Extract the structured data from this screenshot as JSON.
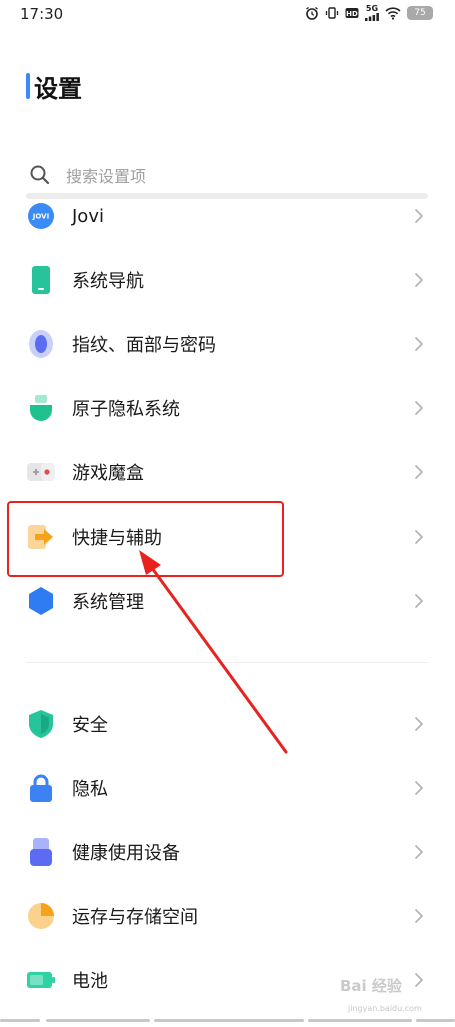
{
  "status_bar": {
    "time": "17:30",
    "network": "5G",
    "battery": "75"
  },
  "header": {
    "title": "设置"
  },
  "search": {
    "placeholder": "搜索设置项"
  },
  "groups": [
    {
      "items": [
        {
          "label": "Jovi",
          "icon": "jovi-icon",
          "color": "#3a8bf5"
        },
        {
          "label": "系统导航",
          "icon": "phone-navigation-icon",
          "color": "#27c39a"
        },
        {
          "label": "指纹、面部与密码",
          "icon": "fingerprint-icon",
          "color": "#5c6cf2"
        },
        {
          "label": "原子隐私系统",
          "icon": "atom-privacy-icon",
          "color": "#21c08f"
        },
        {
          "label": "游戏魔盒",
          "icon": "gamepad-icon",
          "color": "#e24b4b"
        },
        {
          "label": "快捷与辅助",
          "icon": "shortcut-arrow-icon",
          "color": "#f7a21b"
        },
        {
          "label": "系统管理",
          "icon": "hexagon-icon",
          "color": "#2f7bf1"
        }
      ]
    },
    {
      "items": [
        {
          "label": "安全",
          "icon": "shield-icon",
          "color": "#25c49a"
        },
        {
          "label": "隐私",
          "icon": "lock-icon",
          "color": "#3d82f4"
        },
        {
          "label": "健康使用设备",
          "icon": "health-device-icon",
          "color": "#5b6cf3"
        },
        {
          "label": "运存与存储空间",
          "icon": "storage-pie-icon",
          "color": "#f7a21b"
        },
        {
          "label": "电池",
          "icon": "battery-icon",
          "color": "#2fd2a3"
        }
      ]
    }
  ],
  "annotation": {
    "color": "#e8231f"
  },
  "watermark": {
    "text": "Bai 经验",
    "sub": "jingyan.baidu.com"
  }
}
